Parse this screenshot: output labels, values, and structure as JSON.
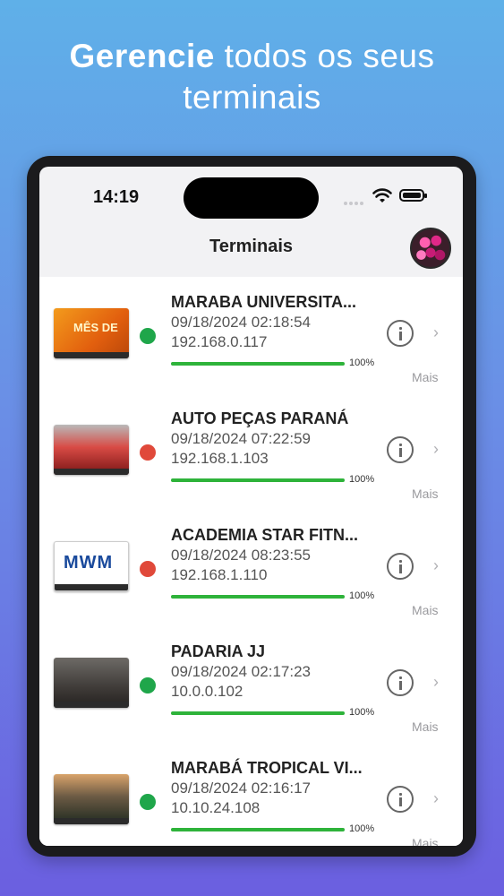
{
  "headline": {
    "bold": "Gerencie",
    "rest_line1": " todos os seus",
    "line2": "terminais"
  },
  "status_bar": {
    "time": "14:19"
  },
  "nav": {
    "title": "Terminais"
  },
  "terminals": [
    {
      "name": "MARABA UNIVERSITA...",
      "date": "09/18/2024 02:18:54",
      "ip": "192.168.0.117",
      "status_color": "#1fa64a",
      "progress": 1.0,
      "progress_label": "100%",
      "more": "Mais",
      "chevron": "›",
      "thumb_text": "MÊS DE"
    },
    {
      "name": "AUTO PEÇAS PARANÁ",
      "date": "09/18/2024 07:22:59",
      "ip": "192.168.1.103",
      "status_color": "#e0493a",
      "progress": 1.0,
      "progress_label": "100%",
      "more": "Mais",
      "chevron": "›",
      "thumb_text": ""
    },
    {
      "name": "ACADEMIA STAR FITN...",
      "date": "09/18/2024 08:23:55",
      "ip": "192.168.1.110",
      "status_color": "#e0493a",
      "progress": 1.0,
      "progress_label": "100%",
      "more": "Mais",
      "chevron": "›",
      "thumb_text": "MWM"
    },
    {
      "name": "PADARIA JJ",
      "date": "09/18/2024 02:17:23",
      "ip": "10.0.0.102",
      "status_color": "#1fa64a",
      "progress": 1.0,
      "progress_label": "100%",
      "more": "Mais",
      "chevron": "›",
      "thumb_text": ""
    },
    {
      "name": "MARABÁ TROPICAL VI...",
      "date": "09/18/2024 02:16:17",
      "ip": "10.10.24.108",
      "status_color": "#1fa64a",
      "progress": 1.0,
      "progress_label": "100%",
      "more": "Mais",
      "chevron": "›",
      "thumb_text": ""
    }
  ]
}
